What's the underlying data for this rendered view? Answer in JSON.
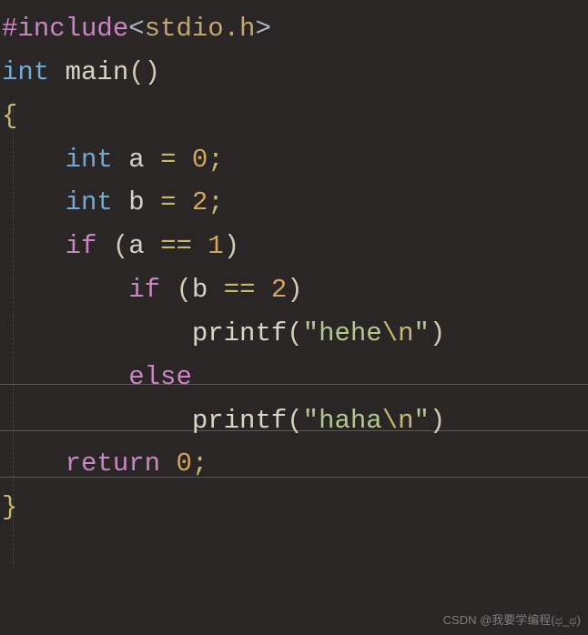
{
  "code": {
    "line1": {
      "preproc": "#include",
      "lt": "<",
      "hdr": "stdio.h",
      "gt": ">"
    },
    "line2": {
      "kw": "int",
      "sp": " ",
      "fn": "main",
      "lp": "(",
      "rp": ")"
    },
    "line3": {
      "brace": "{"
    },
    "line4": {
      "indent": "    ",
      "kw": "int",
      "sp": " ",
      "id": "a",
      "sp2": " ",
      "op": "=",
      "sp3": " ",
      "num": "0",
      "semi": ";"
    },
    "line5": {
      "indent": "    ",
      "kw": "int",
      "sp": " ",
      "id": "b",
      "sp2": " ",
      "op": "=",
      "sp3": " ",
      "num": "2",
      "semi": ";"
    },
    "line6": {
      "indent": "    ",
      "kw": "if",
      "sp": " ",
      "lp": "(",
      "id": "a",
      "sp2": " ",
      "op": "==",
      "sp3": " ",
      "num": "1",
      "rp": ")"
    },
    "line7": {
      "indent": "        ",
      "kw": "if",
      "sp": " ",
      "lp": "(",
      "id": "b",
      "sp2": " ",
      "op": "==",
      "sp3": " ",
      "num": "2",
      "rp": ")"
    },
    "line8": {
      "indent": "            ",
      "fn": "printf",
      "lp": "(",
      "q1": "\"",
      "s1": "hehe",
      "esc": "\\n",
      "q2": "\"",
      "rp": ")"
    },
    "line9": {
      "indent": "        ",
      "kw": "else"
    },
    "line10": {
      "indent": "            ",
      "fn": "printf",
      "lp": "(",
      "q1": "\"",
      "s1": "haha",
      "esc": "\\n",
      "q2": "\"",
      "rp": ")"
    },
    "line11": {
      "indent": "    ",
      "kw": "return",
      "sp": " ",
      "num": "0",
      "semi": ";"
    },
    "line12": {
      "brace": "}"
    }
  },
  "watermark": "CSDN @我要学编程(ಥ_ಥ)"
}
